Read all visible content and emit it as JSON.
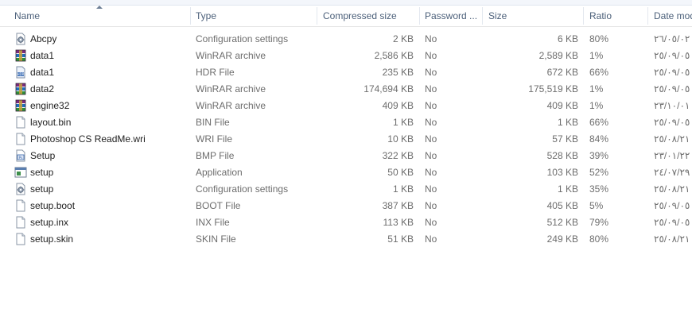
{
  "columns": {
    "name": "Name",
    "type": "Type",
    "compressed": "Compressed size",
    "password": "Password ...",
    "size": "Size",
    "ratio": "Ratio",
    "date": "Date mod"
  },
  "rows": [
    {
      "icon": "config-file-icon",
      "name": "Abcpy",
      "type": "Configuration settings",
      "compressed": "2 KB",
      "password": "No",
      "size": "6 KB",
      "ratio": "80%",
      "date": "٢٦/٠٥/٠٢"
    },
    {
      "icon": "winrar-archive-icon",
      "name": "data1",
      "type": "WinRAR archive",
      "compressed": "2,586 KB",
      "password": "No",
      "size": "2,589 KB",
      "ratio": "1%",
      "date": "٢٥/٠٩/٠٥"
    },
    {
      "icon": "hdr-file-icon",
      "name": "data1",
      "type": "HDR File",
      "compressed": "235 KB",
      "password": "No",
      "size": "672 KB",
      "ratio": "66%",
      "date": "٢٥/٠٩/٠٥"
    },
    {
      "icon": "winrar-archive-icon",
      "name": "data2",
      "type": "WinRAR archive",
      "compressed": "174,694 KB",
      "password": "No",
      "size": "175,519 KB",
      "ratio": "1%",
      "date": "٢٥/٠٩/٠٥"
    },
    {
      "icon": "winrar-archive-icon",
      "name": "engine32",
      "type": "WinRAR archive",
      "compressed": "409 KB",
      "password": "No",
      "size": "409 KB",
      "ratio": "1%",
      "date": "٢٣/١٠/٠١"
    },
    {
      "icon": "blank-file-icon",
      "name": "layout.bin",
      "type": "BIN File",
      "compressed": "1 KB",
      "password": "No",
      "size": "1 KB",
      "ratio": "66%",
      "date": "٢٥/٠٩/٠٥"
    },
    {
      "icon": "blank-file-icon",
      "name": "Photoshop CS ReadMe.wri",
      "type": "WRI File",
      "compressed": "10 KB",
      "password": "No",
      "size": "57 KB",
      "ratio": "84%",
      "date": "٢٥/٠٨/٢١"
    },
    {
      "icon": "photoshop-bmp-icon",
      "name": "Setup",
      "type": "BMP File",
      "compressed": "322 KB",
      "password": "No",
      "size": "528 KB",
      "ratio": "39%",
      "date": "٢٣/٠١/٢٢"
    },
    {
      "icon": "application-icon",
      "name": "setup",
      "type": "Application",
      "compressed": "50 KB",
      "password": "No",
      "size": "103 KB",
      "ratio": "52%",
      "date": "٢٤/٠٧/٢٩"
    },
    {
      "icon": "config-file-icon",
      "name": "setup",
      "type": "Configuration settings",
      "compressed": "1 KB",
      "password": "No",
      "size": "1 KB",
      "ratio": "35%",
      "date": "٢٥/٠٨/٢١"
    },
    {
      "icon": "blank-file-icon",
      "name": "setup.boot",
      "type": "BOOT File",
      "compressed": "387 KB",
      "password": "No",
      "size": "405 KB",
      "ratio": "5%",
      "date": "٢٥/٠٩/٠٥"
    },
    {
      "icon": "blank-file-icon",
      "name": "setup.inx",
      "type": "INX File",
      "compressed": "113 KB",
      "password": "No",
      "size": "512 KB",
      "ratio": "79%",
      "date": "٢٥/٠٩/٠٥"
    },
    {
      "icon": "blank-file-icon",
      "name": "setup.skin",
      "type": "SKIN File",
      "compressed": "51 KB",
      "password": "No",
      "size": "249 KB",
      "ratio": "80%",
      "date": "٢٥/٠٨/٢١"
    }
  ]
}
